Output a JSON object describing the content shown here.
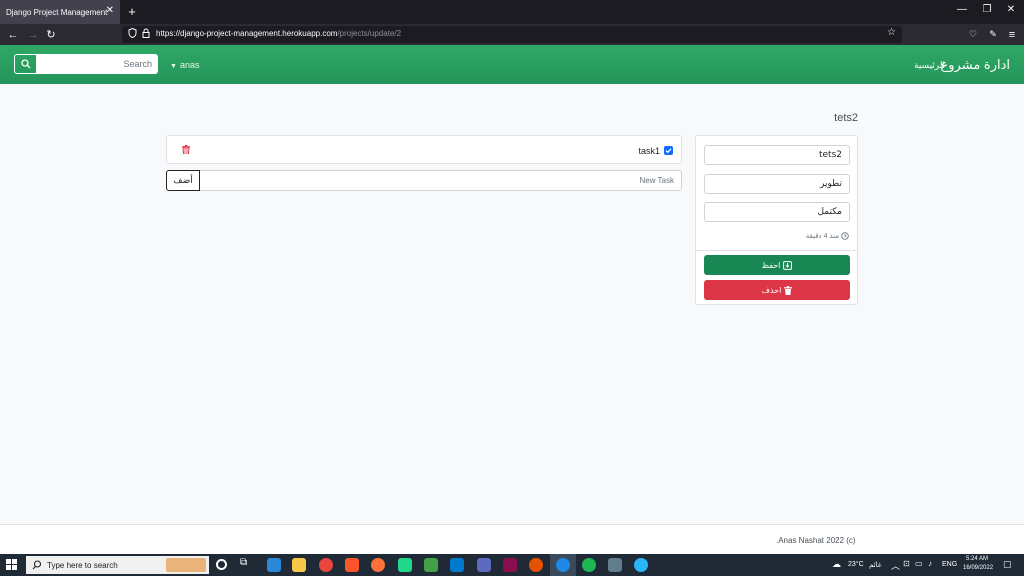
{
  "browser": {
    "tab_title": "Django Project Management",
    "url_main": "https://django-project-management.herokuapp.com",
    "url_path": "/projects/update/2"
  },
  "navbar": {
    "brand": "ادارة مشروع",
    "home_link": "الرئيسية",
    "user_menu": "anas",
    "search_placeholder": "Search"
  },
  "project": {
    "title": "tets2",
    "name_value": "tets2",
    "category_value": "تطوير",
    "status_value": "مكتمل",
    "time_ago": "منذ 4 دقيقة",
    "save_label": "احفظ",
    "delete_label": "احذف"
  },
  "tasks": {
    "items": [
      {
        "label": "task1",
        "done": true
      }
    ],
    "new_task_placeholder": "New Task",
    "add_label": "أضف"
  },
  "footer": {
    "text": ".Anas Nashat 2022 (c)"
  },
  "taskbar": {
    "search_text": "Type here to search",
    "weather": "23°C",
    "weather_label": "غائم",
    "language": "ENG",
    "time": "5:24 AM",
    "date": "16/09/2022"
  },
  "colors": {
    "navbar": "#28a25e",
    "save": "#198754",
    "delete": "#dc3545",
    "checkbox": "#0d6efd"
  }
}
